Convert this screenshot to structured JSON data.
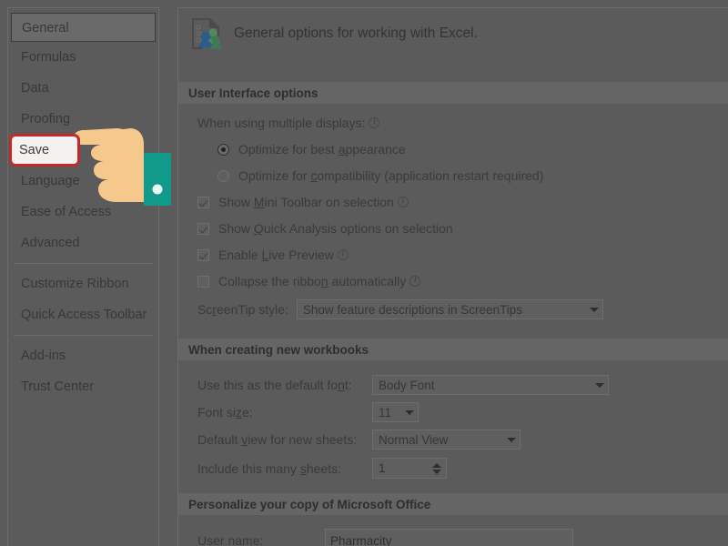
{
  "dialog": {
    "header_title": "General options for working with Excel.",
    "header_icon": "general-options-icon"
  },
  "nav": {
    "items": [
      {
        "label": "General",
        "selected": true
      },
      {
        "label": "Formulas",
        "selected": false
      },
      {
        "label": "Data",
        "selected": false
      },
      {
        "label": "Proofing",
        "selected": false
      },
      {
        "label": "Save",
        "selected": false,
        "highlighted": true
      },
      {
        "label": "Language",
        "selected": false
      },
      {
        "label": "Ease of Access",
        "selected": false
      },
      {
        "label": "Advanced",
        "selected": false
      },
      {
        "label": "Customize Ribbon",
        "selected": false
      },
      {
        "label": "Quick Access Toolbar",
        "selected": false
      },
      {
        "label": "Add-ins",
        "selected": false
      },
      {
        "label": "Trust Center",
        "selected": false
      }
    ],
    "highlight_color": "#c22a2a",
    "highlight_fill": "#f4f2f0"
  },
  "cursor": {
    "name": "pointing-hand-cursor",
    "skin_color": "#f5c98c",
    "sleeve_color": "#11998a",
    "button_color": "#e9f6f4"
  },
  "sections": {
    "ui_options": {
      "title": "User Interface options",
      "multiple_displays_label": "When using multiple displays:",
      "radios": [
        {
          "label_pre": "Optimize for best ",
          "accel": "a",
          "label_post": "ppearance",
          "checked": true
        },
        {
          "label_pre": "Optimize for ",
          "accel": "c",
          "label_post": "ompatibility (application restart required)",
          "checked": false
        }
      ],
      "checkboxes": [
        {
          "label_pre": "Show ",
          "accel": "M",
          "label_post": "ini Toolbar on selection",
          "checked": true,
          "info": true
        },
        {
          "label_pre": "Show ",
          "accel": "Q",
          "label_post": "uick Analysis options on selection",
          "checked": true,
          "info": false
        },
        {
          "label_pre": "Enable ",
          "accel": "L",
          "label_post": "ive Preview",
          "checked": true,
          "info": true
        },
        {
          "label_pre": "Collapse the ribbo",
          "accel": "n",
          "label_post": " automatically",
          "checked": false,
          "info": true
        }
      ],
      "screentip_label_pre": "Sc",
      "screentip_accel": "r",
      "screentip_label_post": "eenTip style:",
      "screentip_value": "Show feature descriptions in ScreenTips"
    },
    "new_workbooks": {
      "title": "When creating new workbooks",
      "default_font_label_pre": "Use this as the default fo",
      "default_font_accel": "n",
      "default_font_label_post": "t:",
      "default_font_value": "Body Font",
      "font_size_label_pre": "Font si",
      "font_size_accel": "z",
      "font_size_label_post": "e:",
      "font_size_value": "11",
      "default_view_label_pre": "Default ",
      "default_view_accel": "v",
      "default_view_label_post": "iew for new sheets:",
      "default_view_value": "Normal View",
      "include_sheets_label_pre": "Include this many ",
      "include_sheets_accel": "s",
      "include_sheets_label_post": "heets:",
      "include_sheets_value": "1"
    },
    "personalize": {
      "title": "Personalize your copy of Microsoft Office",
      "user_name_accel": "U",
      "user_name_label_post": "ser name:",
      "user_name_value": "Pharmacity"
    }
  }
}
